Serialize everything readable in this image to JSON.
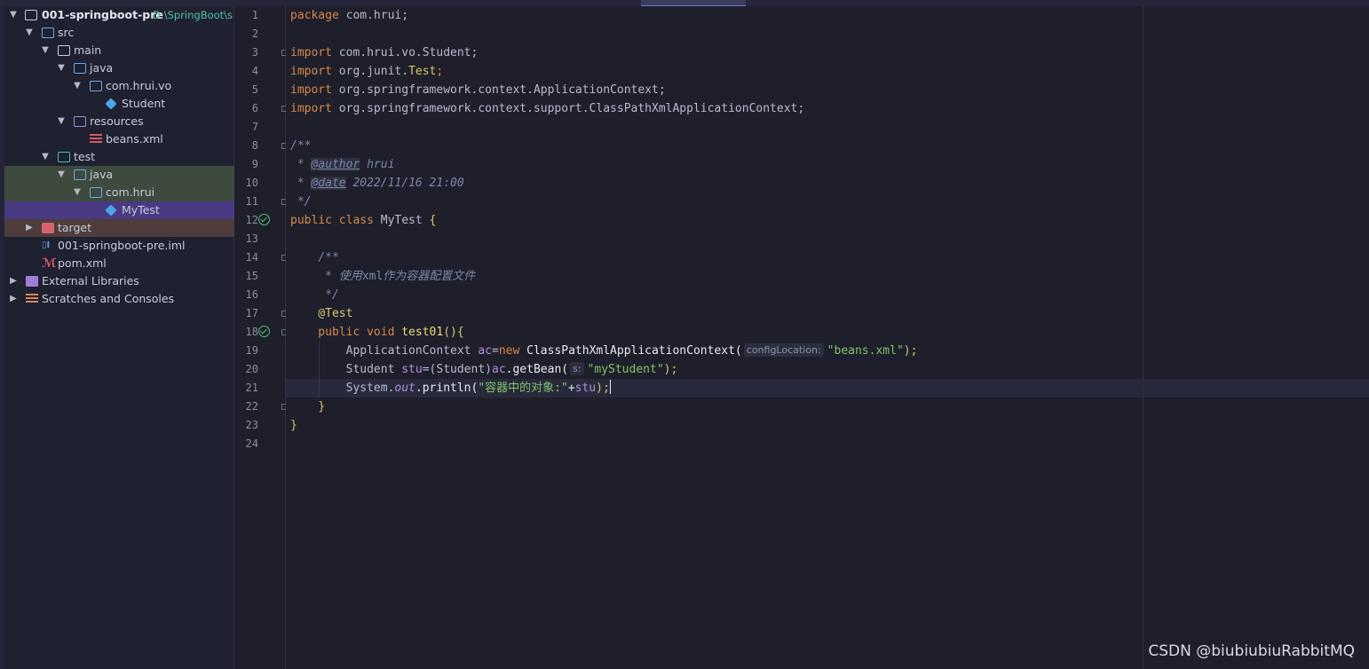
{
  "project": {
    "name": "001-springboot-pre",
    "path": "D:\\SpringBoot\\s"
  },
  "tree": {
    "src": "src",
    "main": "main",
    "java_main": "java",
    "pkg_vo": "com.hrui.vo",
    "student": "Student",
    "resources": "resources",
    "beans": "beans.xml",
    "test": "test",
    "java_test": "java",
    "pkg_hrui": "com.hrui",
    "mytest": "MyTest",
    "target": "target",
    "iml": "001-springboot-pre.iml",
    "pom": "pom.xml",
    "ext_libs": "External Libraries",
    "scratches": "Scratches and Consoles"
  },
  "code": {
    "l1a": "package ",
    "l1b": "com.hrui;",
    "import_kw": "import ",
    "l3": "com.hrui.vo.Student;",
    "l4a": "org.junit.",
    "l4b": "Test",
    "l4c": ";",
    "l5": "org.springframework.context.ApplicationContext;",
    "l6": "org.springframework.context.support.ClassPathXmlApplicationContext;",
    "l8": "/**",
    "l9a": " * ",
    "l9tag": "@author",
    "l9b": " hrui",
    "l10a": " * ",
    "l10tag": "@date",
    "l10b": " 2022/11/16 21:00",
    "l11": " */",
    "l12a": "public class ",
    "l12b": "MyTest ",
    "l12c": "{",
    "l14": "    /**",
    "l15a": "     * ",
    "l15b": "使用",
    "l15c": "xml",
    "l15d": "作为容器配置文件",
    "l16": "     */",
    "l17": "    @Test",
    "l18a": "    public void ",
    "l18b": "test01",
    "l18c": "(){",
    "l19a": "        ApplicationContext ",
    "l19b": "ac",
    "l19c": "=",
    "l19d": "new ",
    "l19e": "ClassPathXmlApplicationContext(",
    "l19hint": "configLocation:",
    "l19f": "\"beans.xml\"",
    "l19g": ");",
    "l20a": "        Student ",
    "l20b": "stu",
    "l20c": "=(Student)",
    "l20d": "ac",
    "l20e": ".getBean(",
    "l20hint": "s:",
    "l20f": "\"myStudent\"",
    "l20g": ");",
    "l21a": "        System.",
    "l21b": "out",
    "l21c": ".println(",
    "l21d": "\"容器中的对象:\"",
    "l21e": "+",
    "l21f": "stu",
    "l21g": ");",
    "l22": "    }",
    "l23": "}"
  },
  "line_numbers": [
    "1",
    "2",
    "3",
    "4",
    "5",
    "6",
    "7",
    "8",
    "9",
    "10",
    "11",
    "12",
    "13",
    "14",
    "15",
    "16",
    "17",
    "18",
    "19",
    "20",
    "21",
    "22",
    "23",
    "24"
  ],
  "watermark": "CSDN @biubiubiuRabbitMQ",
  "colors": {
    "selection_purple": "#4a3a83",
    "selection_green": "#3d4a3d",
    "accent_teal": "#4ec3a1"
  }
}
